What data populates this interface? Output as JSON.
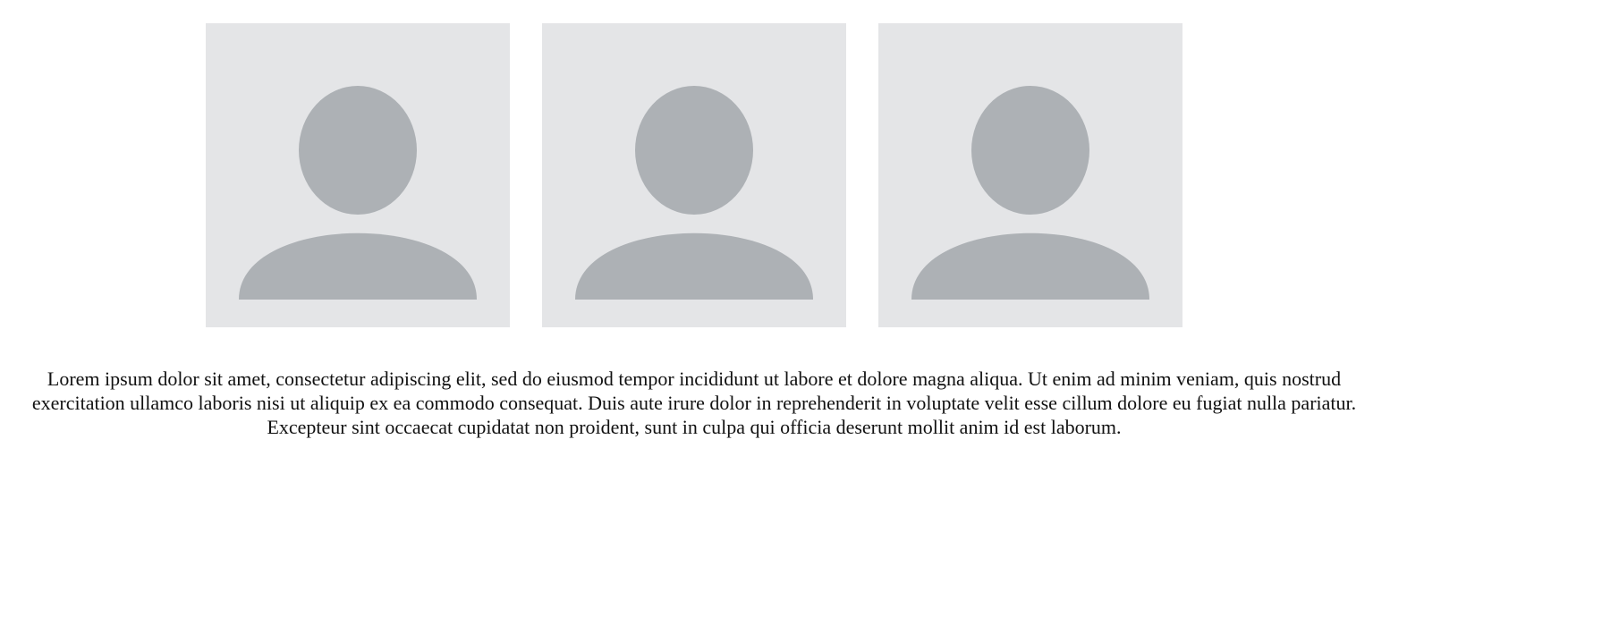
{
  "gallery": {
    "items": [
      {
        "icon": "user-avatar-placeholder-icon"
      },
      {
        "icon": "user-avatar-placeholder-icon"
      },
      {
        "icon": "user-avatar-placeholder-icon"
      }
    ]
  },
  "colors": {
    "page_background": "#ffffff",
    "card_background": "#e4e5e7",
    "silhouette": "#adb1b5",
    "text": "#111111"
  },
  "paragraph": {
    "text": "Lorem ipsum dolor sit amet, consectetur adipiscing elit, sed do eiusmod tempor incididunt ut labore et dolore magna aliqua. Ut enim ad minim veniam, quis nostrud exercitation ullamco laboris nisi ut aliquip ex ea commodo consequat. Duis aute irure dolor in reprehenderit in voluptate velit esse cillum dolore eu fugiat nulla pariatur. Excepteur sint occaecat cupidatat non proident, sunt in culpa qui officia deserunt mollit anim id est laborum."
  }
}
